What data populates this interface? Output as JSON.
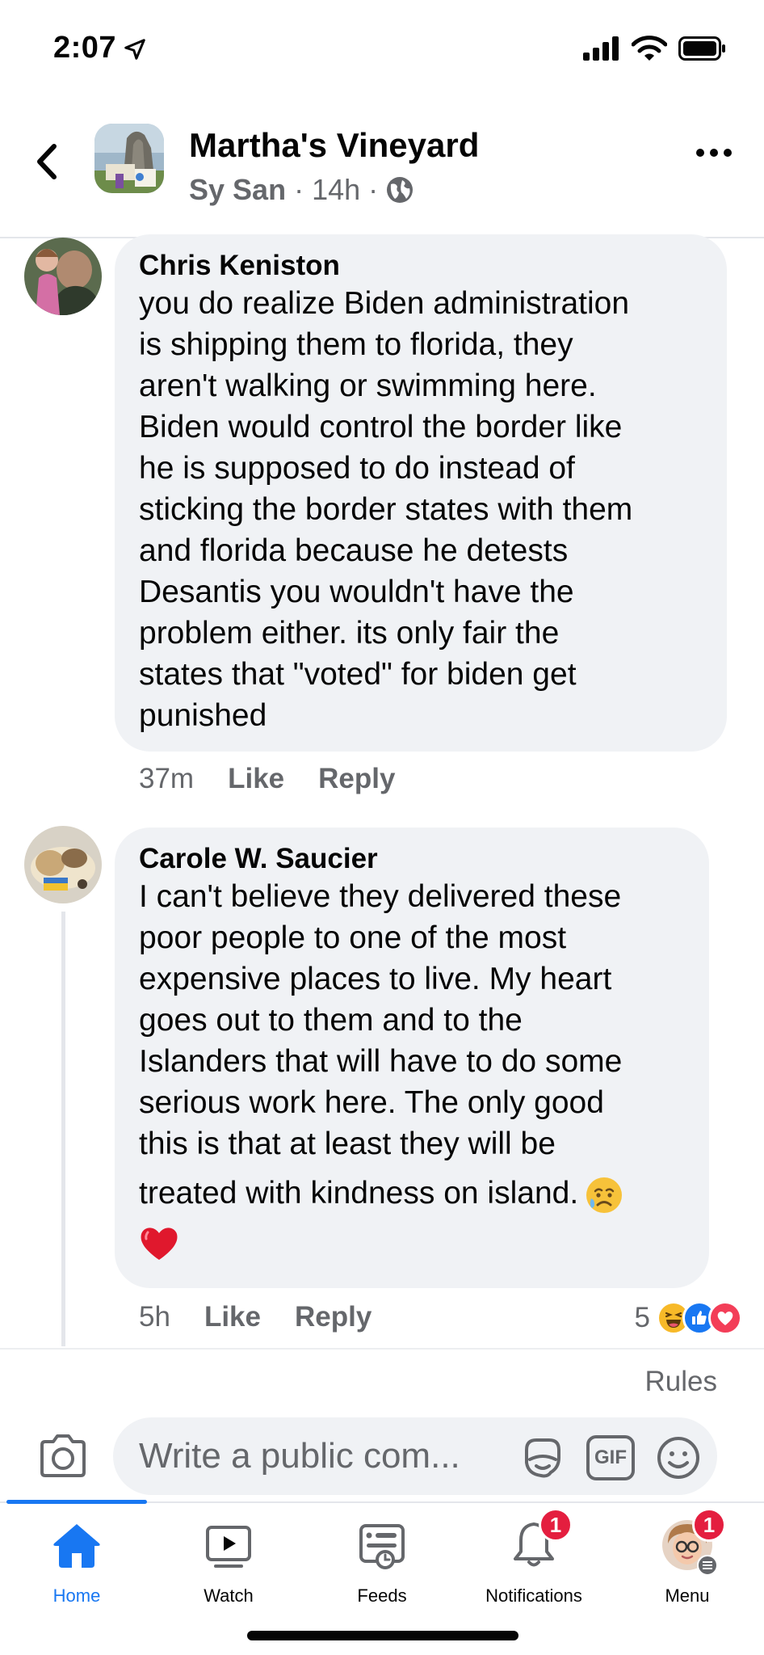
{
  "status_bar": {
    "time": "2:07",
    "icons": [
      "location-arrow-icon",
      "cellular-signal-icon",
      "wifi-icon",
      "battery-icon"
    ]
  },
  "header": {
    "title": "Martha's Vineyard",
    "author": "Sy San",
    "separator": "·",
    "age": "14h",
    "icons": [
      "back-chevron-icon",
      "globe-icon",
      "more-icon"
    ]
  },
  "comments": [
    {
      "author": "Chris Keniston",
      "lines": [
        "you do realize Biden administration",
        "is shipping them to florida, they",
        "aren't walking or swimming here.",
        "Biden would control the border like",
        "he is supposed to do instead of",
        "sticking the border states with them",
        "and florida because he detests",
        "Desantis you wouldn't have the",
        "problem either. its only fair the",
        "states that \"voted\" for biden get",
        "punished"
      ],
      "time": "37m",
      "like_label": "Like",
      "reply_label": "Reply"
    },
    {
      "author": "Carole W. Saucier",
      "lines": [
        "I can't believe they delivered these",
        "poor people to one of the most",
        "expensive places to live. My heart",
        "goes out to them and to the",
        "Islanders that will have to do some",
        "serious work here. The only good",
        "this is that at least they will be",
        "treated with kindness on island."
      ],
      "emojis": [
        "sad-tear-face-emoji",
        "red-heart-emoji"
      ],
      "time": "5h",
      "like_label": "Like",
      "reply_label": "Reply",
      "reaction_count": "5",
      "reactions": [
        "haha-reaction-icon",
        "like-reaction-icon",
        "love-reaction-icon"
      ]
    }
  ],
  "composer": {
    "rules_label": "Rules",
    "placeholder": "Write a public com...",
    "gif_label": "GIF"
  },
  "tabs": [
    {
      "label": "Home",
      "icon": "home-icon",
      "active": true
    },
    {
      "label": "Watch",
      "icon": "watch-icon"
    },
    {
      "label": "Feeds",
      "icon": "feeds-icon"
    },
    {
      "label": "Notifications",
      "icon": "bell-icon",
      "badge": "1"
    },
    {
      "label": "Menu",
      "icon": "profile-avatar",
      "badge": "1"
    }
  ],
  "colors": {
    "accent": "#1877f2",
    "bubble": "#f0f2f5",
    "secondary_text": "#65676b",
    "badge": "#e41e3f"
  }
}
